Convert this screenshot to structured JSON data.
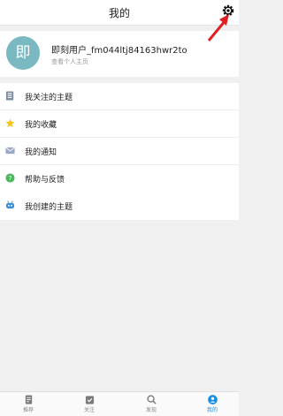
{
  "header": {
    "title": "我的"
  },
  "profile": {
    "avatar_text": "即",
    "username": "即刻用户_fm044ltj84163hwr2to",
    "link": "查看个人主页"
  },
  "menu1": [
    {
      "label": "我关注的主题",
      "icon": "topic-list-icon"
    },
    {
      "label": "我的收藏",
      "icon": "star-icon"
    },
    {
      "label": "我的通知",
      "icon": "mail-icon"
    },
    {
      "label": "帮助与反馈",
      "icon": "help-icon"
    }
  ],
  "menu2": [
    {
      "label": "我创建的主题",
      "icon": "robot-icon"
    }
  ],
  "tabs": [
    {
      "label": "推荐",
      "icon": "doc-icon"
    },
    {
      "label": "关注",
      "icon": "check-icon"
    },
    {
      "label": "发现",
      "icon": "search-icon"
    },
    {
      "label": "我的",
      "icon": "user-icon",
      "active": true
    }
  ],
  "colors": {
    "accent": "#1a8ee3",
    "avatar": "#7ab8c2",
    "annotation_arrow": "#e02020"
  }
}
